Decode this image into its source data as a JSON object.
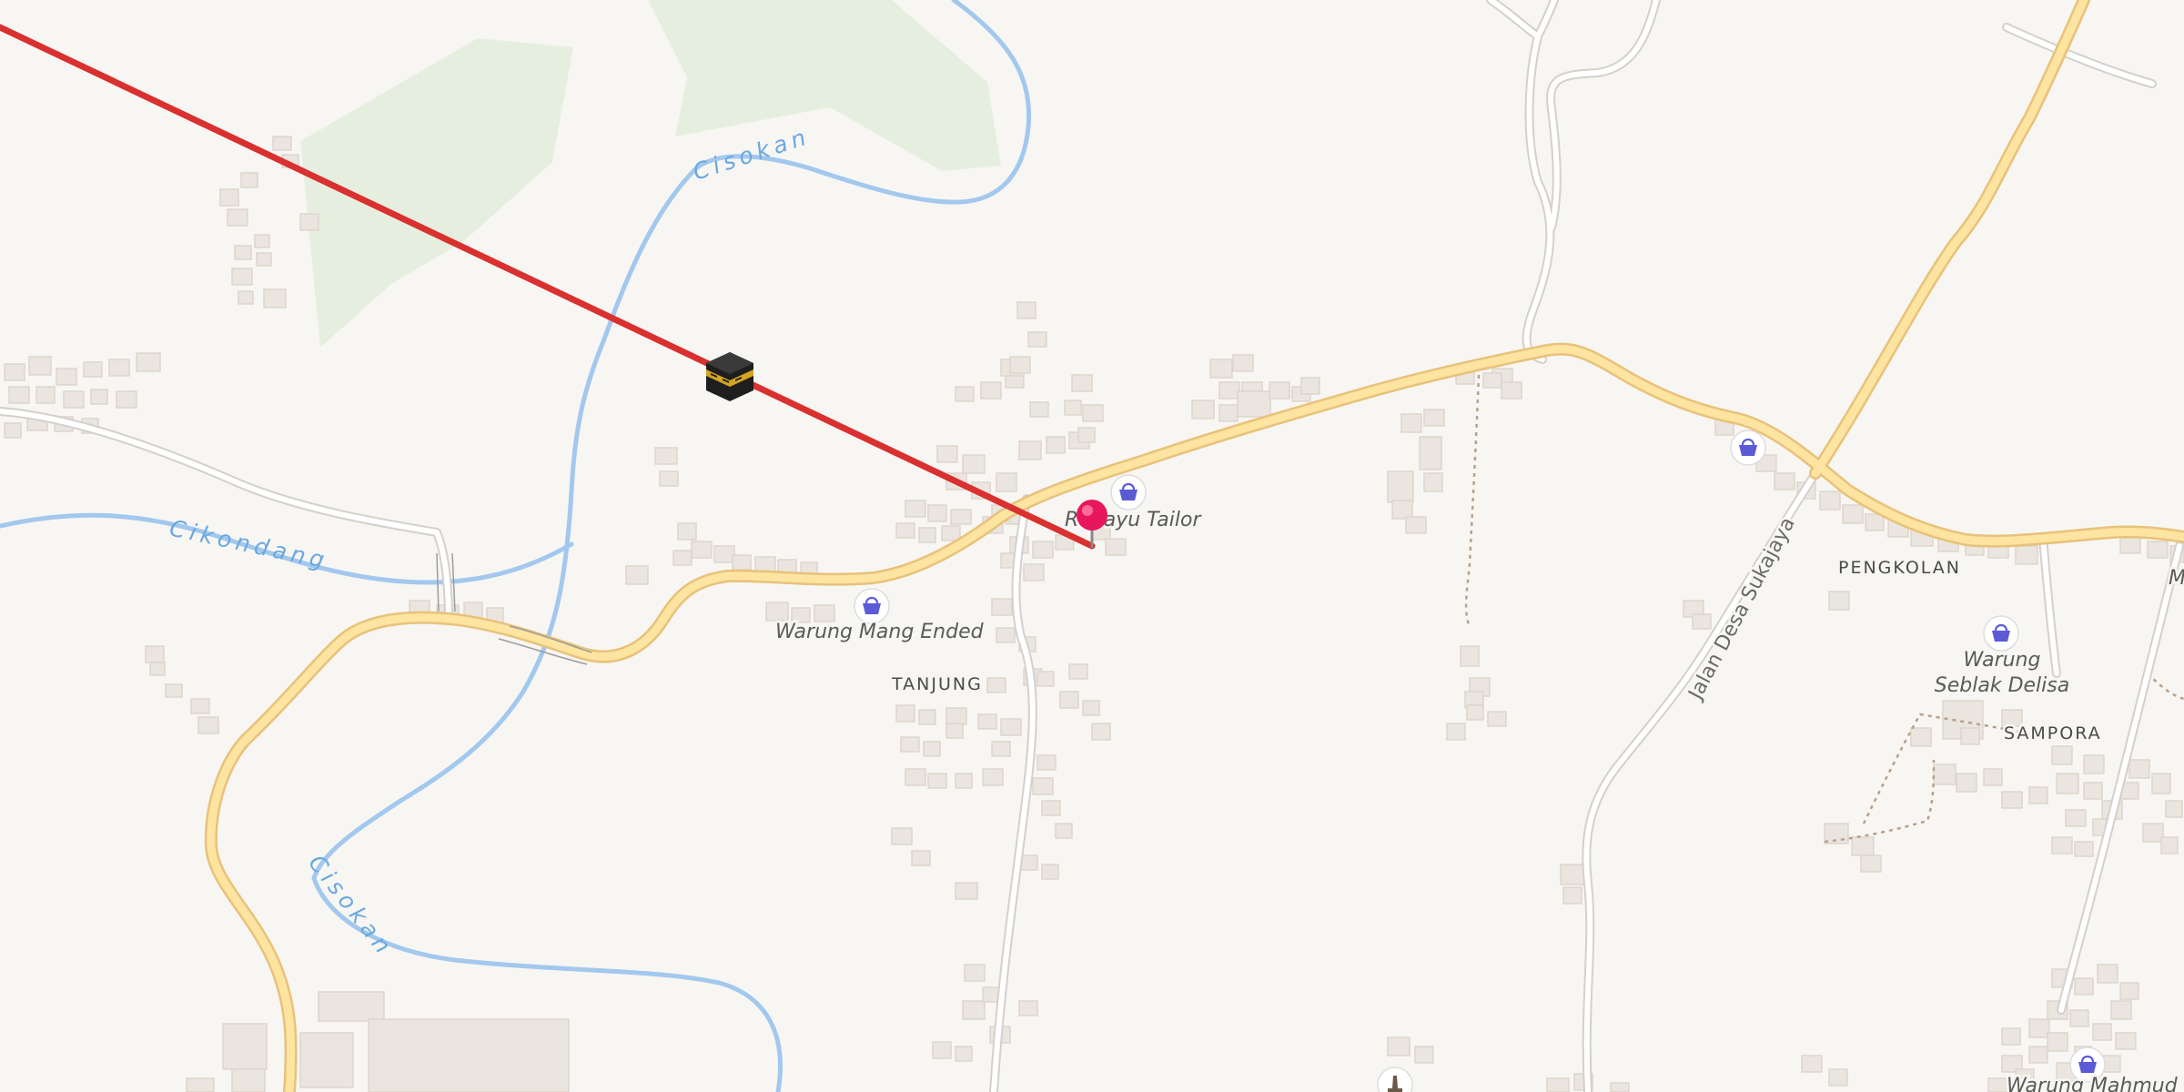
{
  "map": {
    "waterways": [
      "Cisokan",
      "Cikondang",
      "Cisokan"
    ],
    "places": [
      "TANJUNG",
      "PENGKOLAN",
      "SAMPORA"
    ],
    "roads": [
      "Jalan Desa Sukajaya"
    ],
    "pois": [
      {
        "name": "Rahayu Tailor",
        "icon": "shop-basket-icon"
      },
      {
        "name": "Warung Mang Ended",
        "icon": "shop-basket-icon"
      },
      {
        "name": "Warung Seblak Delisa",
        "line1": "Warung",
        "line2": "Seblak Delisa",
        "icon": "shop-basket-icon"
      },
      {
        "name": "Warung Mahmud",
        "icon": "shop-basket-icon"
      }
    ],
    "edge_label_fragment": "M",
    "qibla": {
      "icon": "kaaba-icon",
      "line_color": "#d93030"
    },
    "location_marker": {
      "icon": "location-pin-icon",
      "color": "#e8175d"
    },
    "colors": {
      "background": "#f8f6f3",
      "primary_road": "#fde4a0",
      "primary_road_casing": "#e8c27a",
      "minor_road": "#ffffff",
      "minor_road_casing": "#d4d0cc",
      "water": "#a3c8ee",
      "park": "#e6efdf",
      "building": "#ebe5df",
      "poi_icon": "#5b5bd6"
    }
  }
}
